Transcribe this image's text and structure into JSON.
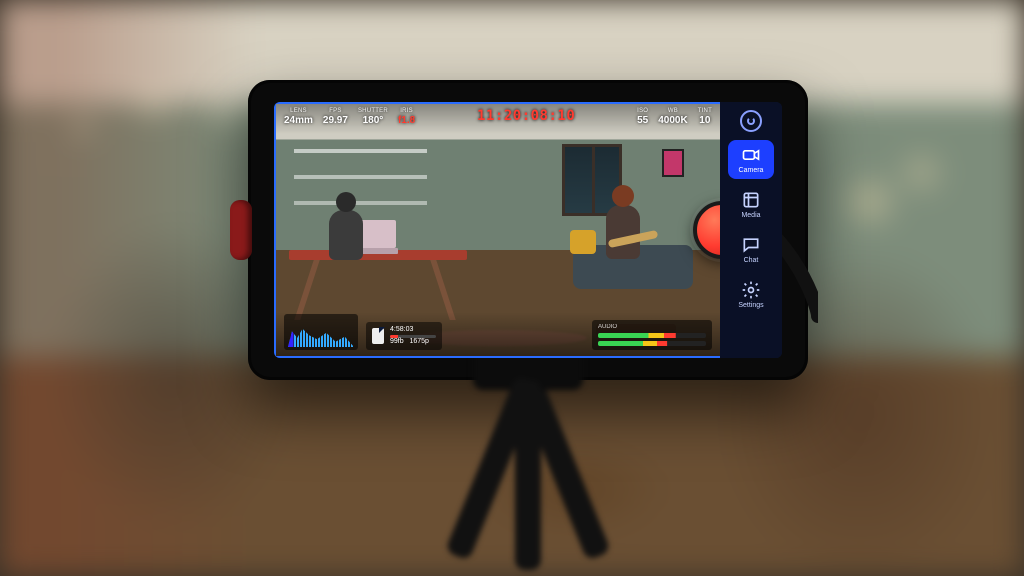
{
  "hud": {
    "lens": {
      "label": "LENS",
      "value": "24mm"
    },
    "fps": {
      "label": "FPS",
      "value": "29.97"
    },
    "shutter": {
      "label": "SHUTTER",
      "value": "180°"
    },
    "iris": {
      "label": "IRIS",
      "value": "f1.8"
    },
    "timecode": "11:20:08:10",
    "iso": {
      "label": "ISO",
      "value": "55"
    },
    "wb": {
      "label": "WB",
      "value": "4000K"
    },
    "tint": {
      "label": "TINT",
      "value": "10"
    }
  },
  "storage": {
    "remaining": "4:58:03",
    "fps_line": "99fb",
    "codec": "1675p"
  },
  "audio": {
    "label": "AUDIO"
  },
  "sidebar": {
    "items": [
      {
        "label": "Camera"
      },
      {
        "label": "Media"
      },
      {
        "label": "Chat"
      },
      {
        "label": "Settings"
      }
    ]
  }
}
